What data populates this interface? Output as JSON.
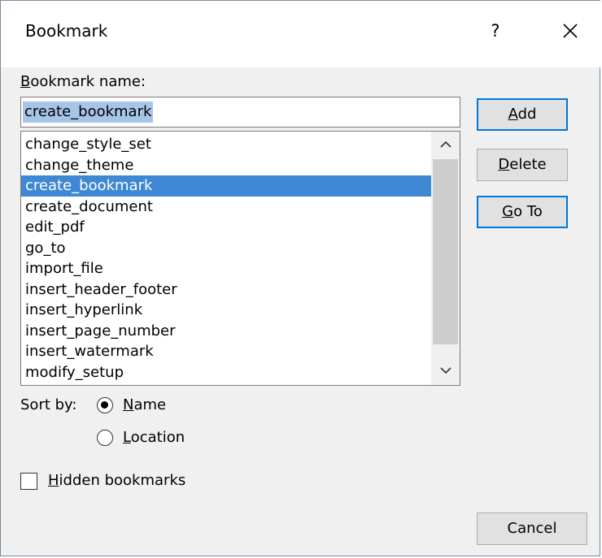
{
  "window": {
    "title": "Bookmark",
    "help_label": "?",
    "close_icon": "close-icon"
  },
  "name_field": {
    "label_accesskey": "B",
    "label_rest": "ookmark name:",
    "value": "create_bookmark"
  },
  "bookmarks": {
    "items": [
      "change_style_set",
      "change_theme",
      "create_bookmark",
      "create_document",
      "edit_pdf",
      "go_to",
      "import_file",
      "insert_header_footer",
      "insert_hyperlink",
      "insert_page_number",
      "insert_watermark",
      "modify_setup"
    ],
    "selected": "create_bookmark"
  },
  "buttons": {
    "add_accesskey": "A",
    "add_rest": "dd",
    "delete_accesskey": "D",
    "delete_rest": "elete",
    "goto_accesskey": "G",
    "goto_rest": "o To",
    "cancel": "Cancel"
  },
  "sort": {
    "label": "Sort by:",
    "name_accesskey": "N",
    "name_rest": "ame",
    "location_accesskey": "L",
    "location_rest": "ocation",
    "selected": "Name"
  },
  "hidden": {
    "label_accesskey": "H",
    "label_rest": "idden bookmarks",
    "checked": false
  },
  "colors": {
    "selection_bg": "#3e88d4",
    "input_selection_bg": "#a7c5e8",
    "default_button_border": "#0078d7",
    "dialog_bg": "#f0f0f0"
  }
}
